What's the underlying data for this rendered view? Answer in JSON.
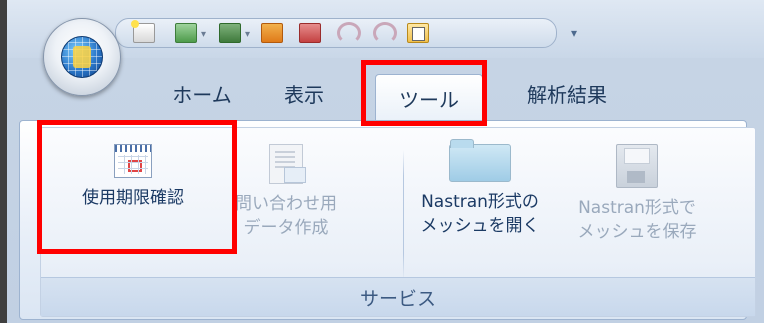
{
  "qat": {
    "items": [
      {
        "name": "new-file-icon"
      },
      {
        "name": "open-file-icon"
      },
      {
        "name": "save-icon"
      },
      {
        "name": "open-folder-icon"
      },
      {
        "name": "save-as-icon"
      },
      {
        "name": "undo-icon"
      },
      {
        "name": "redo-icon"
      },
      {
        "name": "clipboard-icon"
      }
    ],
    "dropdown_glyph": "▾",
    "customize_glyph": "▾"
  },
  "tabs": [
    {
      "label": "ホーム",
      "active": false
    },
    {
      "label": "表示",
      "active": false
    },
    {
      "label": "ツール",
      "active": true
    },
    {
      "label": "解析結果",
      "active": false
    }
  ],
  "ribbon": {
    "group_caption": "サービス",
    "buttons": [
      {
        "line1": "使用期限確認",
        "line2": "",
        "enabled": true,
        "icon": "calendar-icon"
      },
      {
        "line1": "問い合わせ用",
        "line2": "データ作成",
        "enabled": false,
        "icon": "document-icon"
      },
      {
        "line1": "Nastran形式の",
        "line2": "メッシュを開く",
        "enabled": true,
        "icon": "folder-open-icon"
      },
      {
        "line1": "Nastran形式で",
        "line2": "メッシュを保存",
        "enabled": false,
        "icon": "floppy-disk-icon"
      }
    ]
  },
  "colors": {
    "highlight": "#ff0000",
    "tab_text": "#1e395b",
    "enabled_text": "#1b3a64",
    "disabled_text": "#9aa9bc"
  }
}
